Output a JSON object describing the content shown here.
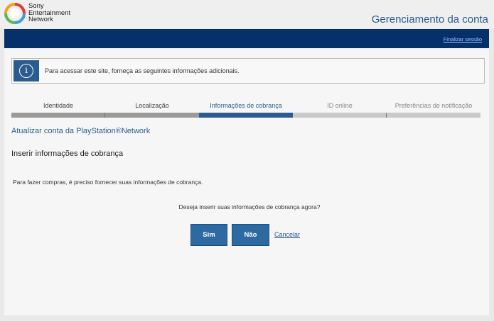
{
  "header": {
    "brand_lines": [
      "Sony",
      "Entertainment",
      "Network"
    ],
    "account_title": "Gerenciamento da conta"
  },
  "nav": {
    "logout_label": "Finalizar sessão"
  },
  "info": {
    "icon": "info-icon",
    "message": "Para acessar este site, forneça as seguintes informações adicionais."
  },
  "steps": [
    {
      "label": "Identidade",
      "state": "done"
    },
    {
      "label": "Localização",
      "state": "done"
    },
    {
      "label": "Informações de cobrança",
      "state": "active"
    },
    {
      "label": "ID online",
      "state": "pending"
    },
    {
      "label": "Preferências de notificação",
      "state": "pending"
    }
  ],
  "section": {
    "link": "Atualizar conta da PlayStation®Network",
    "title": "Inserir informações de cobrança",
    "description": "Para fazer compras, é preciso fornecer suas informações de cobrança.",
    "question": "Deseja inserir suas informações de cobrança agora?"
  },
  "actions": {
    "yes_label": "Sim",
    "no_label": "Não",
    "cancel_label": "Cancelar"
  },
  "colors": {
    "navbar": "#06306a",
    "accent": "#2a5c8f",
    "button": "#2d6aa1"
  }
}
